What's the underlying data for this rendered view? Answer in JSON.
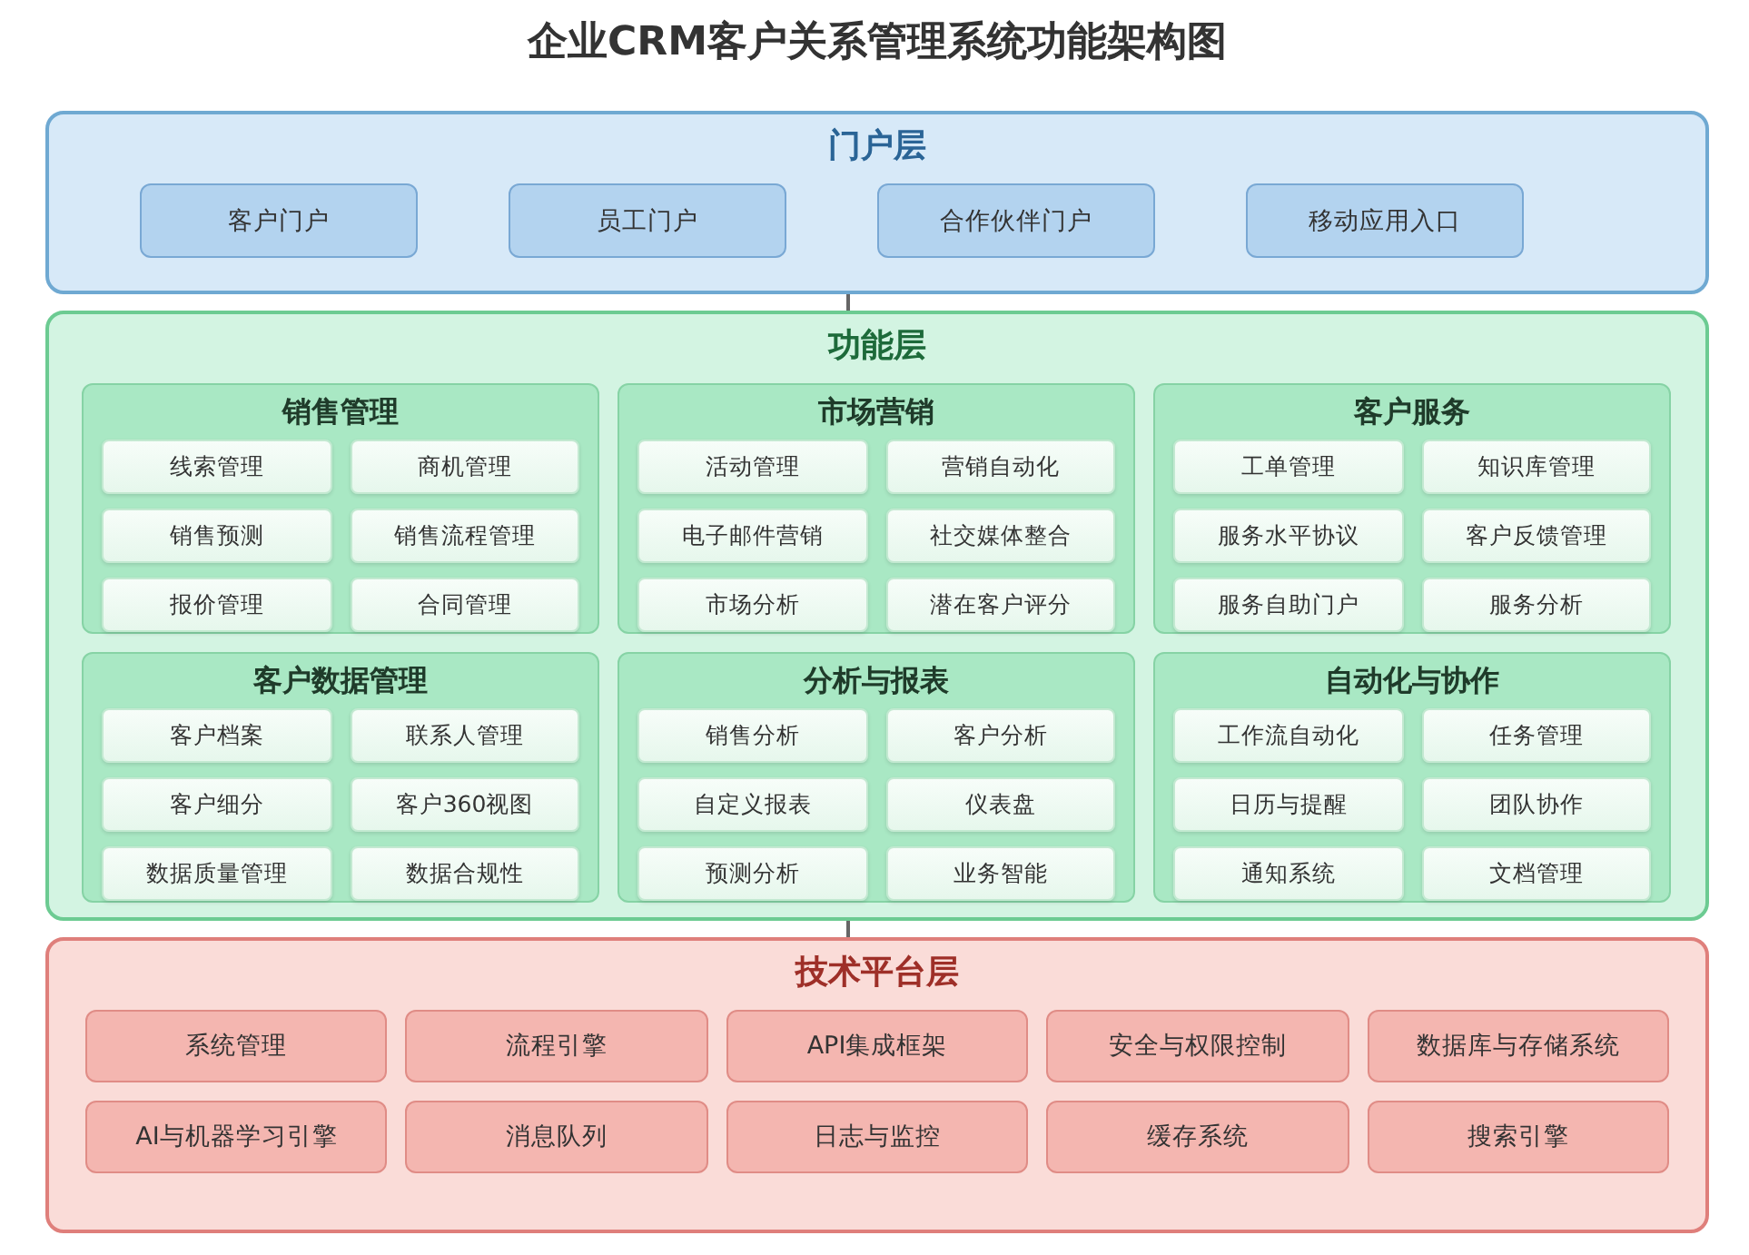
{
  "title": "企业CRM客户关系管理系统功能架构图",
  "layers": [
    {
      "kind": "portal",
      "title": "门户层",
      "items": [
        "客户门户",
        "员工门户",
        "合作伙伴门户",
        "移动应用入口"
      ]
    },
    {
      "kind": "function",
      "title": "功能层",
      "groups": [
        {
          "title": "销售管理",
          "items": [
            "线索管理",
            "商机管理",
            "销售预测",
            "销售流程管理",
            "报价管理",
            "合同管理"
          ]
        },
        {
          "title": "市场营销",
          "items": [
            "活动管理",
            "营销自动化",
            "电子邮件营销",
            "社交媒体整合",
            "市场分析",
            "潜在客户评分"
          ]
        },
        {
          "title": "客户服务",
          "items": [
            "工单管理",
            "知识库管理",
            "服务水平协议",
            "客户反馈管理",
            "服务自助门户",
            "服务分析"
          ]
        },
        {
          "title": "客户数据管理",
          "items": [
            "客户档案",
            "联系人管理",
            "客户细分",
            "客户360视图",
            "数据质量管理",
            "数据合规性"
          ]
        },
        {
          "title": "分析与报表",
          "items": [
            "销售分析",
            "客户分析",
            "自定义报表",
            "仪表盘",
            "预测分析",
            "业务智能"
          ]
        },
        {
          "title": "自动化与协作",
          "items": [
            "工作流自动化",
            "任务管理",
            "日历与提醒",
            "团队协作",
            "通知系统",
            "文档管理"
          ]
        }
      ]
    },
    {
      "kind": "platform",
      "title": "技术平台层",
      "items": [
        "系统管理",
        "流程引擎",
        "API集成框架",
        "安全与权限控制",
        "数据库与存储系统",
        "AI与机器学习引擎",
        "消息队列",
        "日志与监控",
        "缓存系统",
        "搜索引擎"
      ]
    }
  ]
}
